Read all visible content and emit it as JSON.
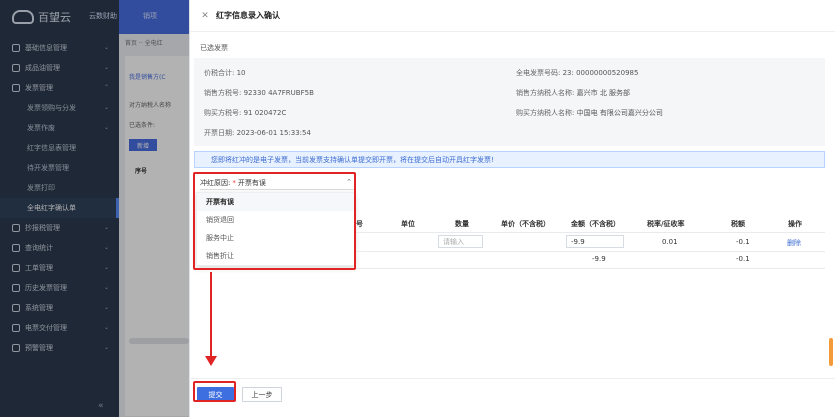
{
  "app": {
    "logo_text": "百望云",
    "top_tabs": [
      "云数财助",
      "销项"
    ]
  },
  "sidebar": {
    "items": [
      {
        "label": "基础信息管理",
        "level": 1
      },
      {
        "label": "成品油管理",
        "level": 1
      },
      {
        "label": "发票管理",
        "level": 1
      },
      {
        "label": "发票领购与分发",
        "level": 2
      },
      {
        "label": "发票作废",
        "level": 2
      },
      {
        "label": "红字信息表管理",
        "level": 2
      },
      {
        "label": "待开发票管理",
        "level": 2
      },
      {
        "label": "发票打印",
        "level": 2
      },
      {
        "label": "全电红字确认单",
        "level": 2,
        "active": true
      },
      {
        "label": "抄报税管理",
        "level": 1
      },
      {
        "label": "查询统计",
        "level": 1
      },
      {
        "label": "工单管理",
        "level": 1
      },
      {
        "label": "历史发票管理",
        "level": 1
      },
      {
        "label": "系统管理",
        "level": 1
      },
      {
        "label": "电票交付管理",
        "level": 1
      },
      {
        "label": "预警管理",
        "level": 1
      }
    ],
    "collapse_glyph": "«"
  },
  "main": {
    "breadcrumb": "首页 ·· 全电红",
    "subtab": "我是销售方(C",
    "rows": [
      "对方纳税人名称",
      "已选条件:"
    ],
    "new_button": "新增",
    "seq_header": "序号"
  },
  "drawer": {
    "title": "红字信息录入确认",
    "section_label": "已选发票",
    "info": {
      "total_label": "价税合计:",
      "total_value": "10",
      "invoice_no_label": "全电发票号码:",
      "invoice_no_value": "23:   00000000520985",
      "seller_tax_label": "销售方税号:",
      "seller_tax_value": "92330   4A7FRUBF5B",
      "seller_name_label": "销售方纳税人名称:",
      "seller_name_value": "嘉兴市   北   服务部",
      "buyer_tax_label": "购买方税号:",
      "buyer_tax_value": "91   020472C",
      "buyer_name_label": "购买方纳税人名称:",
      "buyer_name_value": "中国电   有限公司嘉兴分公司",
      "date_label": "开票日期:",
      "date_value": "2023-06-01 15:33:54"
    },
    "notice": "您即将红冲的是电子发票，当前发票支持确认单提交即开票，将在提交后自动开具红字发票!",
    "reason": {
      "label": "冲红原因:",
      "required_mark": "*",
      "value": "开票有误",
      "options": [
        "开票有误",
        "销货退回",
        "服务中止",
        "销售折让"
      ],
      "selected_index": 0
    },
    "table": {
      "headers": [
        "号",
        "单位",
        "数量",
        "单价（不含税）",
        "金额（不含税）",
        "税率/征收率",
        "税额",
        "操作"
      ],
      "row": {
        "quantity_placeholder": "请输入",
        "amount": "-9.9",
        "tax_rate": "0.01",
        "tax": "-0.1",
        "action": "删除"
      },
      "totals": {
        "amount": "-9.9",
        "tax": "-0.1"
      }
    },
    "footer": {
      "submit_label": "提交",
      "prev_label": "上一步"
    }
  },
  "colors": {
    "primary": "#3d6fe0",
    "highlight": "#e02424",
    "sidebar_bg": "#2b3a4f",
    "notice_bg": "#e8f1ff"
  }
}
